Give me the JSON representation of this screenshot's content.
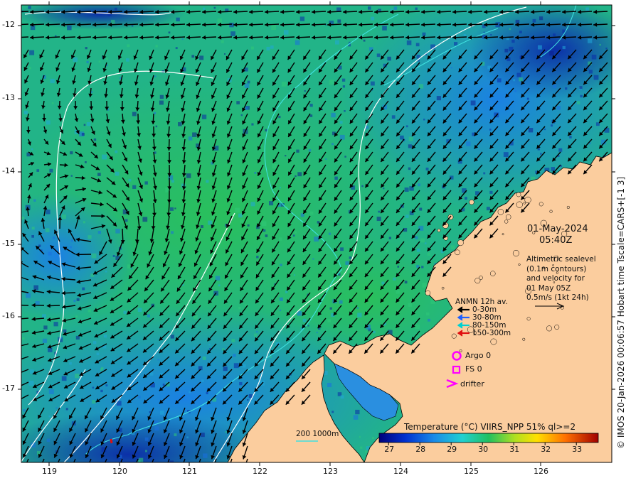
{
  "title_date": "01-May-2024",
  "title_time": "05:40Z",
  "description": [
    "Altimetric sealevel",
    "(0.1m contours)",
    "and velocity for",
    "01 May 05Z",
    "0.5m/s (1kt 24h)"
  ],
  "credit": "© IMOS 20-Jan-2026 00:06:57 Hobart time Tscale=CARS+[-1 3]",
  "x_ticks": [
    "119",
    "120",
    "121",
    "122",
    "123",
    "124",
    "125",
    "126"
  ],
  "y_ticks": [
    "-12",
    "-13",
    "-14",
    "-15",
    "-16",
    "-17"
  ],
  "anmn": {
    "title": "ANMN 12h av.",
    "items": [
      {
        "label": "0-30m",
        "color": "#000000"
      },
      {
        "label": "30-80m",
        "color": "#2060ff"
      },
      {
        "label": "80-150m",
        "color": "#00d0d0"
      },
      {
        "label": "150-300m",
        "color": "#e01010"
      }
    ]
  },
  "markers": {
    "argo": "Argo 0",
    "fs": "FS 0",
    "drifter": "drifter",
    "color": "#ff00ff"
  },
  "isobath_label": "200  1000m",
  "colorbar": {
    "title": "Temperature (°C) VIIRS_NPP 51% ql>=2",
    "ticks": [
      "27",
      "28",
      "29",
      "30",
      "31",
      "32",
      "33"
    ],
    "min": 26.7,
    "max": 33.7
  },
  "colors": {
    "land": "#fbcd9e",
    "water_warm": "#20c060",
    "water_cool": "#1e90e0",
    "water_deep": "#0a2aa8",
    "isobath_200": "#40e0e0",
    "isobath_1000": "#ffffff"
  }
}
